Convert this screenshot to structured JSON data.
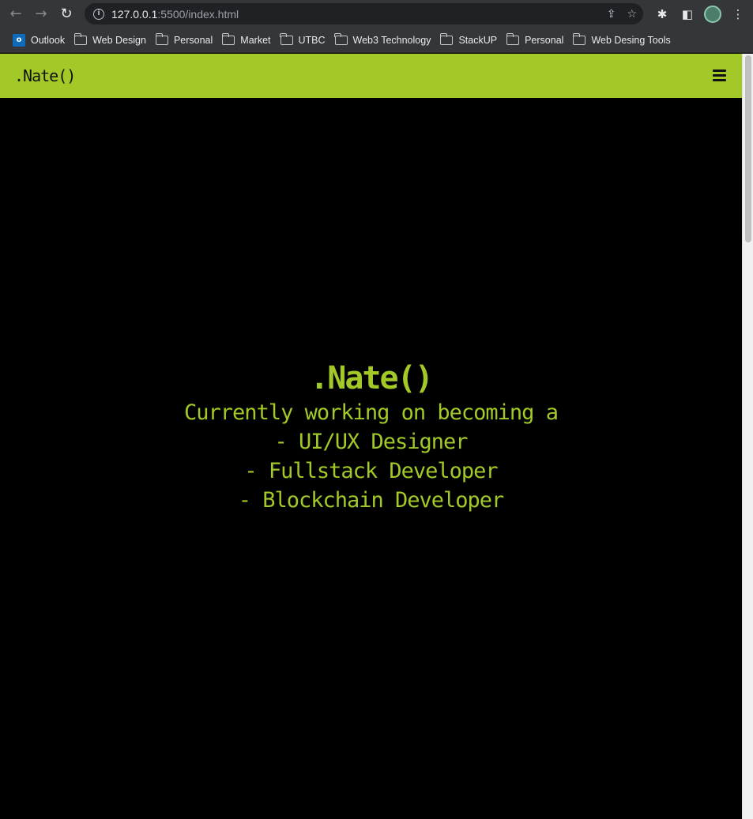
{
  "browser": {
    "url_host": "127.0.0.1",
    "url_rest": ":5500/index.html",
    "back_icon": "←",
    "forward_icon": "→",
    "reload_icon": "↻",
    "info_icon": "i",
    "share_icon": "⇪",
    "star_icon": "☆",
    "extensions_icon": "✱",
    "sidepanel_icon": "◧",
    "menu_icon": "⋮"
  },
  "bookmarks": [
    {
      "label": "Outlook",
      "icon": "outlook-icon"
    },
    {
      "label": "Web Design",
      "icon": "folder-icon"
    },
    {
      "label": "Personal",
      "icon": "folder-icon"
    },
    {
      "label": "Market",
      "icon": "folder-icon"
    },
    {
      "label": "UTBC",
      "icon": "folder-icon"
    },
    {
      "label": "Web3 Technology",
      "icon": "folder-icon"
    },
    {
      "label": "StackUP",
      "icon": "folder-icon"
    },
    {
      "label": "Personal",
      "icon": "folder-icon"
    },
    {
      "label": "Web Desing Tools",
      "icon": "folder-icon"
    }
  ],
  "outlook_letter": "o",
  "site": {
    "logo": ".Nate()",
    "hero": {
      "title": ".Nate()",
      "lines": [
        "Currently working on becoming a",
        "- UI/UX Designer",
        "- Fullstack Developer",
        "- Blockchain Developer"
      ]
    }
  },
  "colors": {
    "accent": "#a2c927",
    "background": "#000000",
    "chrome": "#35363a"
  }
}
